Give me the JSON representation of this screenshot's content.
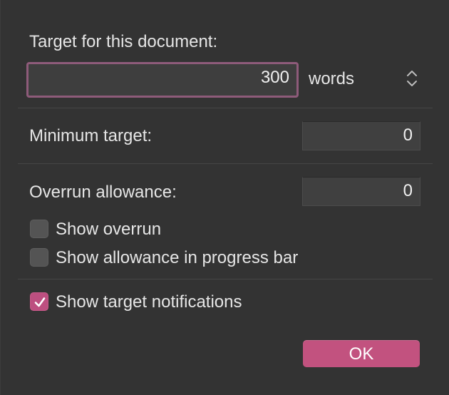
{
  "dialog": {
    "target_label": "Target for this document:",
    "target_value": "300",
    "unit_selected": "words",
    "minimum_label": "Minimum target:",
    "minimum_value": "0",
    "overrun_label": "Overrun allowance:",
    "overrun_value": "0",
    "show_overrun_label": "Show overrun",
    "show_overrun_checked": false,
    "show_allowance_label": "Show allowance in progress bar",
    "show_allowance_checked": false,
    "show_notifications_label": "Show target notifications",
    "show_notifications_checked": true,
    "ok_label": "OK"
  },
  "colors": {
    "accent": "#c2527f",
    "focus_ring": "#8e5b7a",
    "background": "#333333"
  }
}
